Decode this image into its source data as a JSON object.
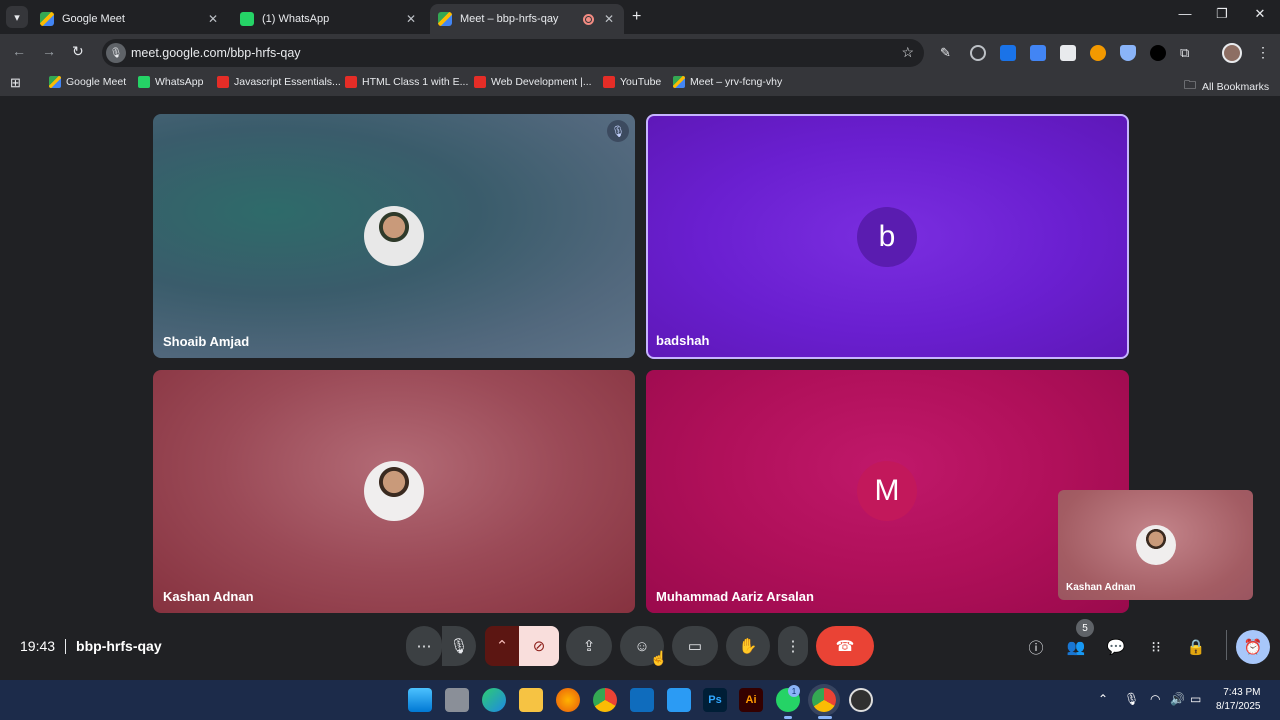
{
  "browser": {
    "tabs": [
      {
        "title": "Google Meet",
        "active": false,
        "icon": "google-meet-icon"
      },
      {
        "title": "(1) WhatsApp",
        "active": false,
        "icon": "whatsapp-icon"
      },
      {
        "title": "Meet – bbp-hrfs-qay",
        "active": true,
        "icon": "google-meet-icon"
      }
    ],
    "url": "meet.google.com/bbp-hrfs-qay",
    "bookmarks": [
      {
        "label": "Google Meet",
        "icon": "google-meet-icon"
      },
      {
        "label": "WhatsApp",
        "icon": "whatsapp-icon"
      },
      {
        "label": "Javascript Essentials...",
        "icon": "youtube-icon"
      },
      {
        "label": "HTML Class 1 with E...",
        "icon": "youtube-icon"
      },
      {
        "label": "Web Development |...",
        "icon": "youtube-icon"
      },
      {
        "label": "YouTube",
        "icon": "youtube-icon"
      },
      {
        "label": "Meet – yrv-fcng-vhy",
        "icon": "google-meet-icon"
      }
    ],
    "all_bookmarks": "All Bookmarks"
  },
  "meeting": {
    "time": "19:43",
    "code": "bbp-hrfs-qay",
    "participant_count": "5",
    "participants": [
      {
        "name": "Shoaib Amjad",
        "muted": true,
        "avatar": "photo"
      },
      {
        "name": "badshah",
        "avatar_letter": "b",
        "speaking": true
      },
      {
        "name": "Kashan Adnan",
        "avatar": "photo"
      },
      {
        "name": "Muhammad Aariz Arsalan",
        "avatar_letter": "M"
      }
    ],
    "self_view_name": "Kashan Adnan"
  },
  "taskbar": {
    "time": "7:43 PM",
    "date": "8/17/2025",
    "whatsapp_badge": "1",
    "apps": [
      "windows-start-icon",
      "task-view-icon",
      "edge-icon",
      "file-explorer-icon",
      "firefox-icon",
      "chrome-icon",
      "outlook-icon",
      "vscode-icon",
      "photoshop-icon",
      "illustrator-icon",
      "whatsapp-icon",
      "chrome-icon",
      "obs-icon"
    ],
    "ps_label": "Ps",
    "ai_label": "Ai"
  },
  "colors": {
    "accent_blue": "#a8c7fa",
    "end_call_red": "#ea4335",
    "badshah_tile": "#6a1fd0",
    "aariz_tile": "#b0105a"
  }
}
